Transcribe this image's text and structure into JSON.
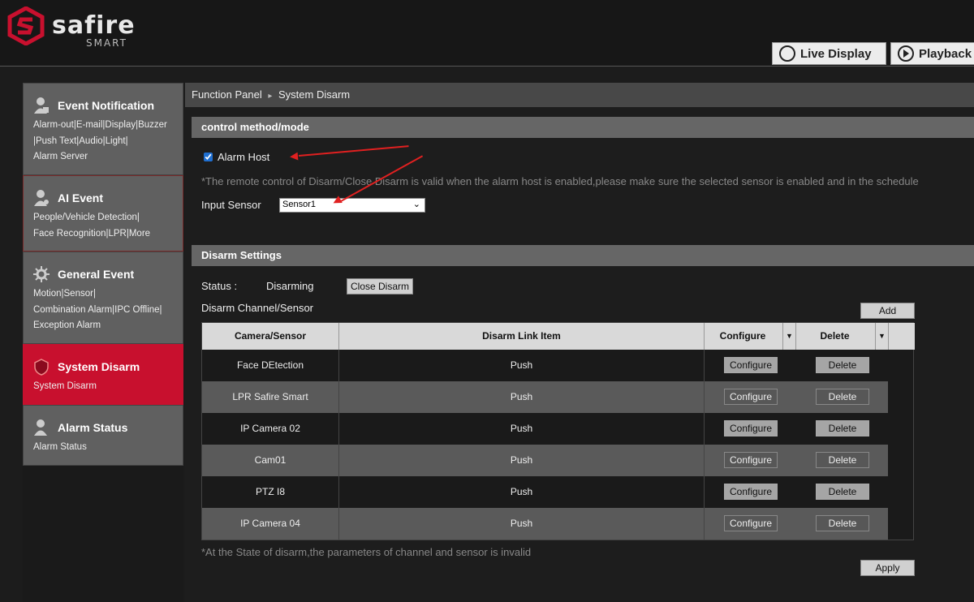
{
  "brand": {
    "name": "safire",
    "sub": "SMART"
  },
  "top_buttons": {
    "live": "Live Display",
    "playback": "Playback"
  },
  "sidebar": {
    "items": [
      {
        "title": "Event Notification",
        "sub": [
          "Alarm-out|E-mail|Display|Buzzer",
          "|Push Text|Audio|Light|",
          "Alarm Server"
        ]
      },
      {
        "title": "AI Event",
        "sub": [
          "People/Vehicle Detection|",
          "Face Recognition|LPR|More"
        ]
      },
      {
        "title": "General Event",
        "sub": [
          "Motion|Sensor|",
          "Combination Alarm|IPC Offline|",
          "Exception Alarm"
        ]
      },
      {
        "title": "System Disarm",
        "sub": [
          "System Disarm"
        ]
      },
      {
        "title": "Alarm Status",
        "sub": [
          "Alarm Status"
        ]
      }
    ]
  },
  "breadcrumb": {
    "root": "Function Panel",
    "sep": "▸",
    "current": "System Disarm"
  },
  "control": {
    "title": "control method/mode",
    "alarm_host_label": "Alarm Host",
    "alarm_host_checked": true,
    "note": "*The remote control of Disarm/Close Disarm is valid when the alarm host is enabled,please make sure the selected sensor is enabled and in the schedule",
    "input_sensor_label": "Input Sensor",
    "input_sensor_value": "Sensor1"
  },
  "disarm": {
    "title": "Disarm Settings",
    "status_label": "Status :",
    "status_value": "Disarming",
    "close_button": "Close Disarm",
    "channel_label": "Disarm Channel/Sensor",
    "add_button": "Add",
    "columns": [
      "Camera/Sensor",
      "Disarm Link Item",
      "Configure",
      "Delete"
    ],
    "rows": [
      {
        "name": "Face DEtection",
        "link": "Push",
        "configure": "Configure",
        "delete": "Delete"
      },
      {
        "name": "LPR Safire Smart",
        "link": "Push",
        "configure": "Configure",
        "delete": "Delete"
      },
      {
        "name": "IP Camera 02",
        "link": "Push",
        "configure": "Configure",
        "delete": "Delete"
      },
      {
        "name": "Cam01",
        "link": "Push",
        "configure": "Configure",
        "delete": "Delete"
      },
      {
        "name": "PTZ I8",
        "link": "Push",
        "configure": "Configure",
        "delete": "Delete"
      },
      {
        "name": "IP Camera 04",
        "link": "Push",
        "configure": "Configure",
        "delete": "Delete"
      }
    ],
    "footer_note": "*At the State of disarm,the parameters of channel and sensor is invalid",
    "apply_button": "Apply"
  },
  "colors": {
    "accent": "#c8102e",
    "annotation": "#e02020"
  }
}
